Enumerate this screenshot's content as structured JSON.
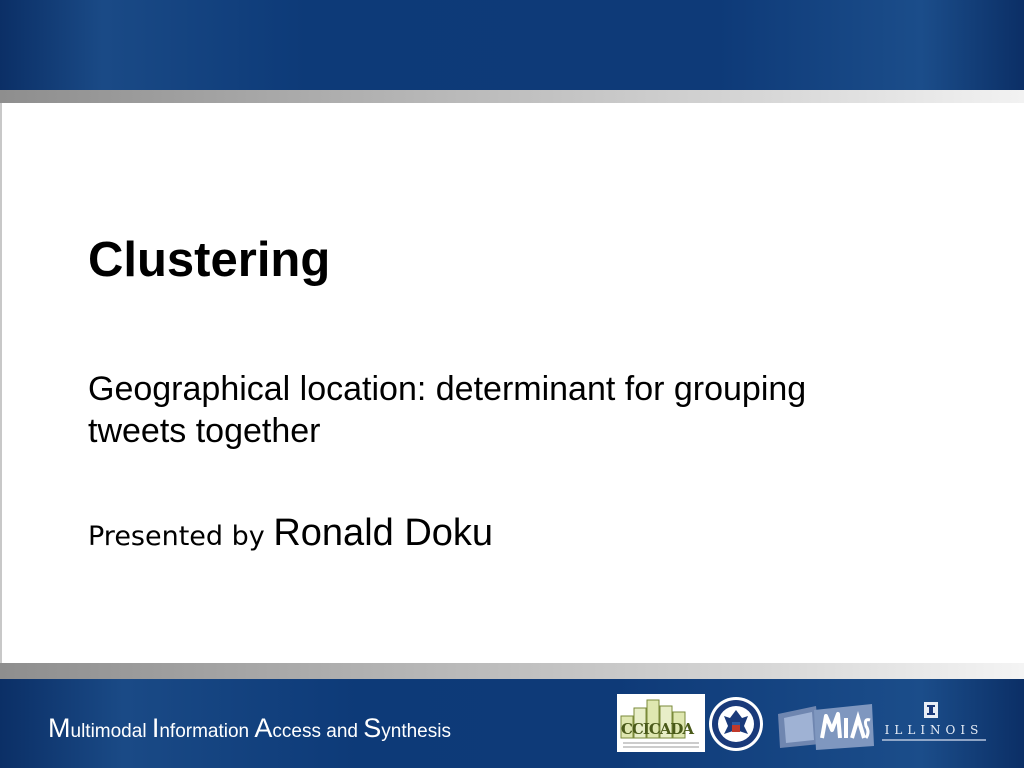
{
  "slide": {
    "title": "Clustering",
    "subtitle": "Geographical location: determinant for grouping tweets together",
    "presenter_prefix": "Presented by ",
    "presenter_name": "Ronald Doku"
  },
  "footer": {
    "words": [
      {
        "initial": "M",
        "rest": "ultimodal "
      },
      {
        "initial": "I",
        "rest": "nformation "
      },
      {
        "initial": "A",
        "rest": "ccess and "
      },
      {
        "initial": "S",
        "rest": "ynthesis"
      }
    ],
    "logos": {
      "ccicada": "CCICADA",
      "illinois": "ILLINOIS"
    }
  },
  "colors": {
    "header_blue": "#0d3a78",
    "stripe_gray": "#b5b5b5",
    "text": "#000000",
    "footer_text": "#ffffff"
  },
  "icons": [
    "ccicada-logo-icon",
    "dhs-seal-icon",
    "mias-logo-icon",
    "illinois-logo-icon"
  ]
}
